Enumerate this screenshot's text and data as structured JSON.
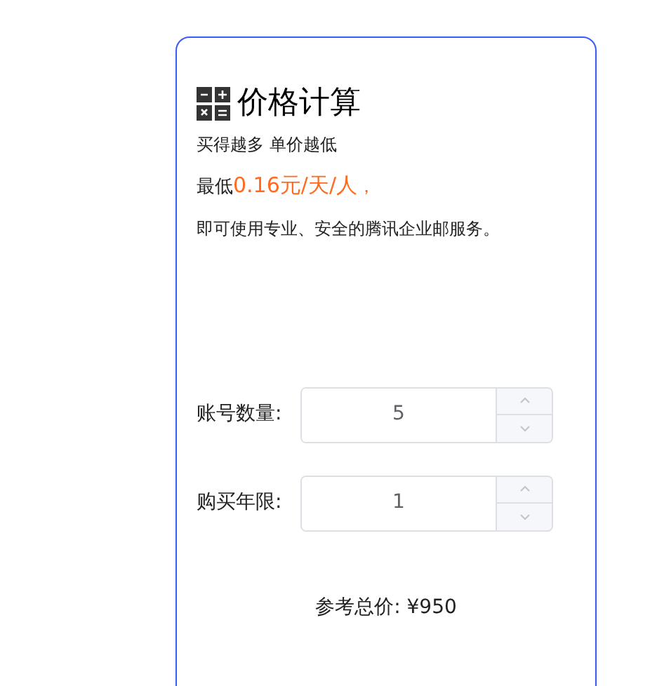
{
  "card": {
    "title": "价格计算",
    "subtitle": "买得越多 单价越低",
    "price_prefix": "最低",
    "price": "0.16元/天/人",
    "price_suffix": "，",
    "description": "即可使用专业、安全的腾讯企业邮服务。",
    "fields": [
      {
        "label": "账号数量:",
        "value": "5"
      },
      {
        "label": "购买年限:",
        "value": "1"
      }
    ],
    "total": "参考总价: ¥950"
  }
}
